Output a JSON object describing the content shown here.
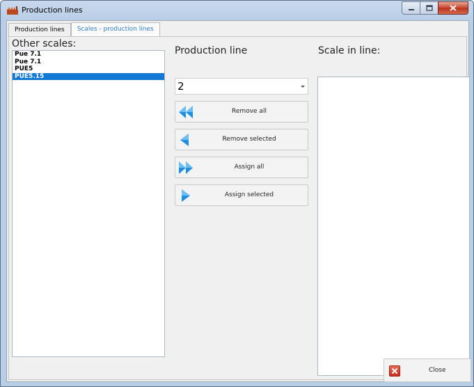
{
  "window": {
    "title": "Production lines"
  },
  "tabs": [
    {
      "label": "Production lines",
      "active": false
    },
    {
      "label": "Scales - production lines",
      "active": true
    }
  ],
  "left_panel": {
    "label": "Other scales:",
    "items": [
      {
        "label": "Pue 7.1",
        "selected": false
      },
      {
        "label": "Pue 7.1",
        "selected": false
      },
      {
        "label": "PUE5",
        "selected": false
      },
      {
        "label": "PUE5.15",
        "selected": true
      }
    ]
  },
  "middle_panel": {
    "label": "Production line",
    "combo_value": "2",
    "buttons": {
      "remove_all": "Remove all",
      "remove_selected": "Remove selected",
      "assign_all": "Assign all",
      "assign_selected": "Assign selected"
    }
  },
  "right_panel": {
    "label": "Scale in line:",
    "items": []
  },
  "footer": {
    "close_label": "Close"
  },
  "colors": {
    "accent": "#1379d4",
    "tab_active_text": "#2f7fd4",
    "arrow_icon": "#1f8fe0"
  }
}
